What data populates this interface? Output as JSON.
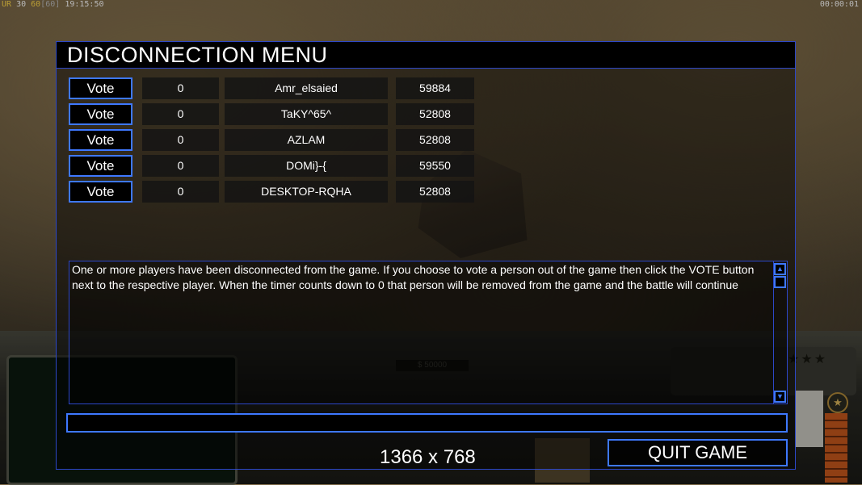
{
  "hud": {
    "ur_label": "UR",
    "ur_value": "30",
    "fps": "60",
    "fps_cap": "[60]",
    "clock": "19:15:50",
    "game_timer": "00:00:01"
  },
  "background": {
    "money_display": "$ 50000"
  },
  "dialog": {
    "title": "DISCONNECTION MENU",
    "vote_label": "Vote",
    "players": [
      {
        "votes": "0",
        "name": "Amr_elsaied",
        "ping": "59884"
      },
      {
        "votes": "0",
        "name": "TaKY^65^",
        "ping": "52808"
      },
      {
        "votes": "0",
        "name": "AZLAM",
        "ping": "52808"
      },
      {
        "votes": "0",
        "name": "DOMi}-{",
        "ping": "59550"
      },
      {
        "votes": "0",
        "name": "DESKTOP-RQHA",
        "ping": "52808"
      }
    ],
    "message": "One or more players have been disconnected from the game. If you choose to vote a person out of the game then click the VOTE button next to the respective player. When the timer counts down to 0 that person will be removed from the game and the battle will continue",
    "chat_value": "",
    "quit_label": "QUIT GAME"
  },
  "overlay_text": {
    "resolution": "1366 x 768"
  },
  "colors": {
    "border_accent": "#3e78ff",
    "panel_border": "#2c47c8",
    "hud_yellow": "#ffd84a"
  }
}
